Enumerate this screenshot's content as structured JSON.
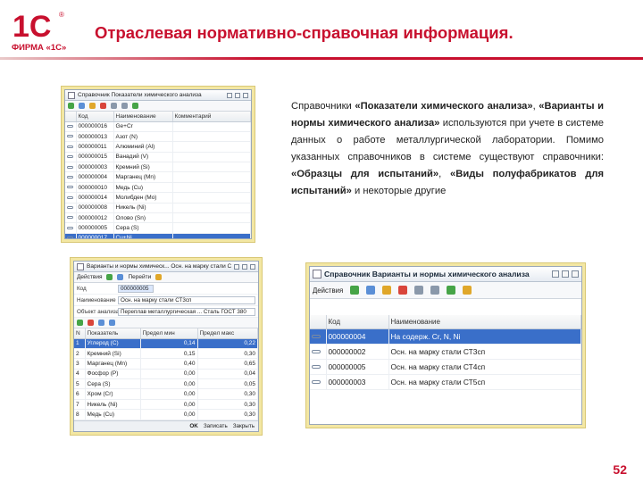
{
  "header": {
    "logo_top": "1С",
    "logo_registered": "®",
    "logo_bottom": "ФИРМА «1С»",
    "title": "Отраслевая нормативно-справочная информация."
  },
  "colors": {
    "brand": "#c8102e",
    "frame": "#f3e7a3",
    "selection": "#3a6fc9"
  },
  "window1": {
    "title": "Справочник Показатели химического анализа",
    "columns": [
      "Код",
      "Наименование",
      "Комментарий"
    ],
    "rows": [
      {
        "code": "000000016",
        "name": "Ge+Cr",
        "selected": false
      },
      {
        "code": "000000013",
        "name": "Азот (N)",
        "selected": false
      },
      {
        "code": "000000011",
        "name": "Алюминий (Al)",
        "selected": false
      },
      {
        "code": "000000015",
        "name": "Ванадий (V)",
        "selected": false
      },
      {
        "code": "000000003",
        "name": "Кремний (Si)",
        "selected": false
      },
      {
        "code": "000000004",
        "name": "Марганец (Mn)",
        "selected": false
      },
      {
        "code": "000000010",
        "name": "Медь (Cu)",
        "selected": false
      },
      {
        "code": "000000014",
        "name": "Молибден (Mo)",
        "selected": false
      },
      {
        "code": "000000008",
        "name": "Никель (Ni)",
        "selected": false
      },
      {
        "code": "000000012",
        "name": "Олово (Sn)",
        "selected": false
      },
      {
        "code": "000000005",
        "name": "Сера (S)",
        "selected": false
      },
      {
        "code": "000000017",
        "name": "Cu+Ni",
        "selected": true
      },
      {
        "code": "000000002",
        "name": "Углерод (C)",
        "selected": false
      }
    ]
  },
  "description": {
    "p1": "Справочники ",
    "b1": "«Показатели химического анализа»",
    "p2": ", ",
    "b2": "«Варианты и нормы химического анализа»",
    "p3": " используются при учете в системе данных о работе металлургической лаборатории. Помимо указанных справочников в системе существуют справочники: ",
    "b3": "«Образцы для испытаний»",
    "p4": ", ",
    "b4": "«Виды полуфабрикатов для испытаний»",
    "p5": " и некоторые другие"
  },
  "window2": {
    "title": "Варианты и нормы химическ...   Осн. на марку стали СТ3сп",
    "toolbar": [
      "Действия",
      "Перейти"
    ],
    "fields": [
      {
        "label": "Код",
        "value": "000000005",
        "highlight": true
      },
      {
        "label": "Наименование",
        "value": "Осн. на марку стали СТ3сп",
        "highlight": false
      },
      {
        "label": "Объект анализа",
        "value": "Переплав металлургическая ... Сталь ГОСТ 380",
        "highlight": false
      }
    ],
    "columns": [
      "N",
      "Показатель",
      "Предел мин",
      "Предел макс"
    ],
    "rows": [
      {
        "n": "1",
        "name": "Углерод (C)",
        "min": "0,14",
        "max": "0,22",
        "selected": true
      },
      {
        "n": "2",
        "name": "Кремний (Si)",
        "min": "0,15",
        "max": "0,30",
        "selected": false
      },
      {
        "n": "3",
        "name": "Марганец (Mn)",
        "min": "0,40",
        "max": "0,65",
        "selected": false
      },
      {
        "n": "4",
        "name": "Фосфор (P)",
        "min": "0,00",
        "max": "0,04",
        "selected": false
      },
      {
        "n": "5",
        "name": "Сера (S)",
        "min": "0,00",
        "max": "0,05",
        "selected": false
      },
      {
        "n": "6",
        "name": "Хром (Cr)",
        "min": "0,00",
        "max": "0,30",
        "selected": false
      },
      {
        "n": "7",
        "name": "Никель (Ni)",
        "min": "0,00",
        "max": "0,30",
        "selected": false
      },
      {
        "n": "8",
        "name": "Медь (Cu)",
        "min": "0,00",
        "max": "0,30",
        "selected": false
      },
      {
        "n": "9",
        "name": "Азот (N)",
        "min": "0,00",
        "max": "0,01",
        "selected": false
      }
    ],
    "status": {
      "ok": "OK",
      "save": "Записать",
      "close": "Закрыть"
    }
  },
  "window3": {
    "title": "Справочник Варианты и нормы химического анализа",
    "toolbar_label": "Действия",
    "columns": [
      "Код",
      "Наименование"
    ],
    "rows": [
      {
        "code": "000000004",
        "name": "На содерж. Cr, N, Ni",
        "selected": true
      },
      {
        "code": "000000002",
        "name": "Осн. на марку стали СТ3сп",
        "selected": false
      },
      {
        "code": "000000005",
        "name": "Осн. на марку стали СТ4сп",
        "selected": false
      },
      {
        "code": "000000003",
        "name": "Осн. на марку стали СТ5сп",
        "selected": false
      }
    ]
  },
  "footer": {
    "page_number": "52"
  }
}
